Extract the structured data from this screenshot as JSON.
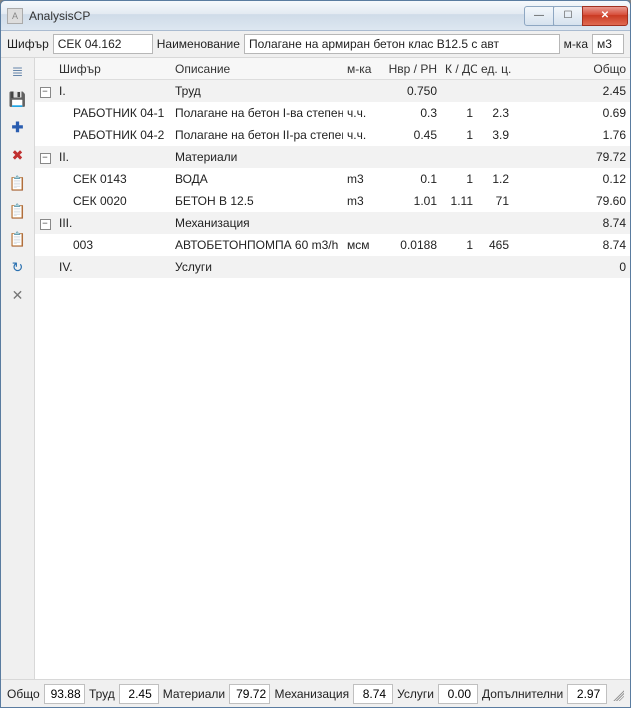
{
  "window": {
    "title": "AnalysisCP"
  },
  "top": {
    "code_label": "Шифър",
    "code_value": "СЕК 04.162",
    "name_label": "Наименование",
    "name_value": "Полагане на армиран бетон клас В12.5 с авт",
    "unit_label": "м-ка",
    "unit_value": "м3"
  },
  "columns": {
    "code": "Шифър",
    "desc": "Описание",
    "mka": "м-ка",
    "nvr": "Нвр / РН",
    "k": "К / ДСР",
    "ed": "ед. ц.",
    "total": "Общо"
  },
  "rows": [
    {
      "type": "group",
      "expanded": true,
      "num": "I.",
      "desc": "Труд",
      "mka": "",
      "nvr": "0.750",
      "k": "",
      "dsr": "",
      "ed": "",
      "total": "2.45"
    },
    {
      "type": "item",
      "code": "РАБОТНИК 04-1",
      "desc": "Полагане на бетон I-ва степен",
      "mka": "ч.ч.",
      "nvr": "0.3",
      "k": "1",
      "dsr": "2.3",
      "ed": "",
      "total": "0.69"
    },
    {
      "type": "item",
      "code": "РАБОТНИК 04-2",
      "desc": "Полагане на бетон II-ра степен",
      "mka": "ч.ч.",
      "nvr": "0.45",
      "k": "1",
      "dsr": "3.9",
      "ed": "",
      "total": "1.76"
    },
    {
      "type": "group",
      "expanded": true,
      "num": "II.",
      "desc": "Материали",
      "mka": "",
      "nvr": "",
      "k": "",
      "dsr": "",
      "ed": "",
      "total": "79.72"
    },
    {
      "type": "item",
      "code": "СЕК 0143",
      "desc": "ВОДА",
      "mka": "m3",
      "nvr": "0.1",
      "k": "1",
      "dsr": "1.2",
      "ed": "",
      "total": "0.12"
    },
    {
      "type": "item",
      "code": "СЕК 0020",
      "desc": "БЕТОН В 12.5",
      "mka": "m3",
      "nvr": "1.01",
      "k": "1.11",
      "dsr": "71",
      "ed": "",
      "total": "79.60"
    },
    {
      "type": "group",
      "expanded": true,
      "num": "III.",
      "desc": "Механизация",
      "mka": "",
      "nvr": "",
      "k": "",
      "dsr": "",
      "ed": "",
      "total": "8.74"
    },
    {
      "type": "item",
      "code": "003",
      "desc": "АВТОБЕТОНПОМПА 60 m3/h",
      "mka": "мсм",
      "nvr": "0.0188",
      "k": "1",
      "dsr": "465",
      "ed": "",
      "total": "8.74"
    },
    {
      "type": "group",
      "expanded": false,
      "num": "IV.",
      "desc": "Услуги",
      "mka": "",
      "nvr": "",
      "k": "",
      "dsr": "",
      "ed": "",
      "total": "0"
    }
  ],
  "status": {
    "total_label": "Общо",
    "total": "93.88",
    "labor_label": "Труд",
    "labor": "2.45",
    "materials_label": "Материали",
    "materials": "79.72",
    "mech_label": "Механизация",
    "mech": "8.74",
    "services_label": "Услуги",
    "services": "0.00",
    "extra_label": "Допълнителни",
    "extra": "2.97"
  },
  "icons": {
    "list": "≣",
    "save": "💾",
    "plus": "✚",
    "delete": "✖",
    "clip1": "📋",
    "clip2": "📋",
    "clip3": "📋",
    "refresh": "↻",
    "tools": "✕"
  }
}
